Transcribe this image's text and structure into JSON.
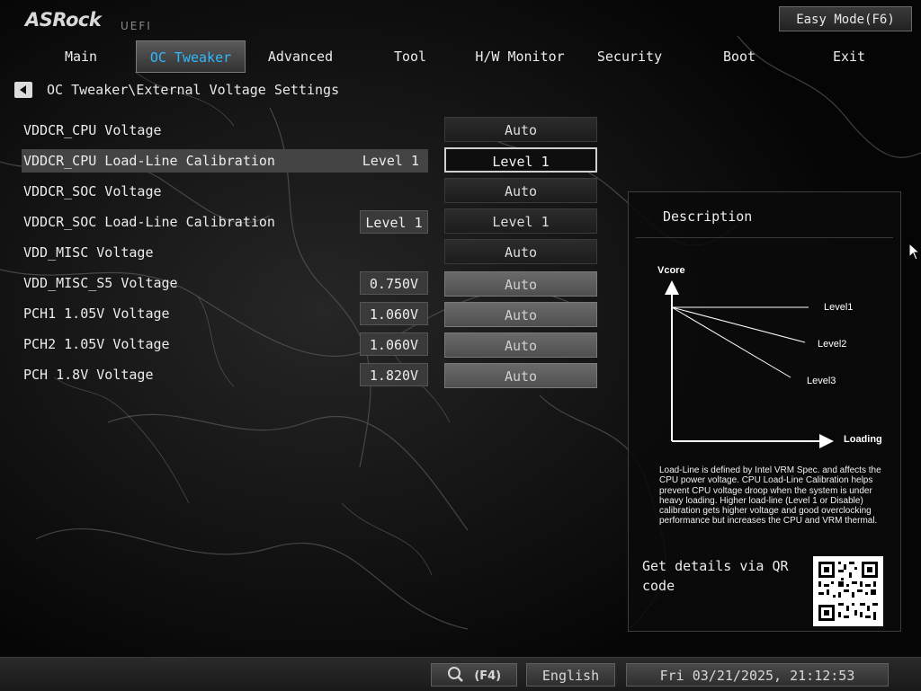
{
  "header": {
    "logo": "ASRock",
    "logo_sub": "UEFI",
    "easy_mode_label": "Easy Mode(F6)"
  },
  "tabs": [
    {
      "label": "Main",
      "active": false
    },
    {
      "label": "OC Tweaker",
      "active": true
    },
    {
      "label": "Advanced",
      "active": false
    },
    {
      "label": "Tool",
      "active": false
    },
    {
      "label": "H/W Monitor",
      "active": false
    },
    {
      "label": "Security",
      "active": false
    },
    {
      "label": "Boot",
      "active": false
    },
    {
      "label": "Exit",
      "active": false
    }
  ],
  "breadcrumb": "OC Tweaker\\External Voltage Settings",
  "settings": [
    {
      "label": "VDDCR_CPU Voltage",
      "current": "",
      "value": "Auto"
    },
    {
      "label": "VDDCR_CPU Load-Line Calibration",
      "current": "Level 1",
      "value": "Level 1"
    },
    {
      "label": "VDDCR_SOC Voltage",
      "current": "",
      "value": "Auto"
    },
    {
      "label": "VDDCR_SOC Load-Line Calibration",
      "current": "Level 1",
      "value": "Level 1"
    },
    {
      "label": "VDD_MISC Voltage",
      "current": "",
      "value": "Auto"
    },
    {
      "label": "VDD_MISC_S5 Voltage",
      "current": "0.750V",
      "value": "Auto"
    },
    {
      "label": "PCH1 1.05V Voltage",
      "current": "1.060V",
      "value": "Auto"
    },
    {
      "label": "PCH2 1.05V Voltage",
      "current": "1.060V",
      "value": "Auto"
    },
    {
      "label": "PCH 1.8V Voltage",
      "current": "1.820V",
      "value": "Auto"
    }
  ],
  "description": {
    "title": "Description",
    "diagram": {
      "y_label": "Vcore",
      "x_label": "Loading",
      "levels": [
        "Level1",
        "Level2",
        "Level3"
      ]
    },
    "text": "Load-Line is defined by Intel VRM Spec. and affects the CPU power voltage. CPU Load-Line Calibration helps prevent CPU voltage droop when the system is under heavy loading. Higher load-line (Level 1 or Disable) calibration gets higher voltage and good overclocking performance but increases the CPU and VRM thermal.",
    "qr_text": "Get details via QR code"
  },
  "footer": {
    "search_label": "(F4)",
    "language": "English",
    "datetime": "Fri 03/21/2025, 21:12:53"
  }
}
